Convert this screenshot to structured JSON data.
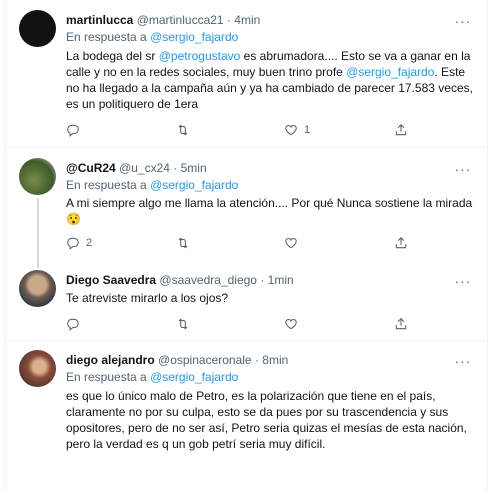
{
  "tweets": [
    {
      "name": "martinlucca",
      "handle": "@martinlucca21",
      "time": "· 4min",
      "reply_prefix": "En respuesta a",
      "reply_to": "@sergio_fajardo",
      "body_a": "La bodega del sr ",
      "body_mention_1": "@petrogustavo",
      "body_b": " es abrumadora.... Esto se va a ganar en la calle y no en la redes sociales, muy buen trino profe ",
      "body_mention_2": "@sergio_fajardo",
      "body_c": ". Este no ha llegado a la campaña aún y ya ha cambiado de parecer 17.583 veces, es un politiquero de 1era",
      "reply_count": "",
      "retweet_count": "",
      "like_count": "1"
    },
    {
      "name": "@CuR24",
      "handle": "@u_cx24",
      "time": "· 5min",
      "reply_prefix": "En respuesta a",
      "reply_to": "@sergio_fajardo",
      "body": "A mi siempre algo me llama la atención.... Por qué Nunca sostiene la mirada 😯",
      "reply_count": "2",
      "retweet_count": "",
      "like_count": ""
    },
    {
      "name": "Diego Saavedra",
      "handle": "@saavedra_diego",
      "time": "· 1min",
      "body": "Te atreviste mirarlo a los ojos?",
      "reply_count": "",
      "retweet_count": "",
      "like_count": ""
    },
    {
      "name": "diego alejandro",
      "handle": "@ospinaceronale",
      "time": "· 8min",
      "reply_prefix": "En respuesta a",
      "reply_to": "@sergio_fajardo",
      "body": "es que lo único malo de Petro, es la polarización que tiene en el país, claramente no por su culpa, esto se da pues por su trascendencia y sus opositores, pero de no ser así, Petro seria quizas el mesías de esta nación, pero la verdad es q un gob petrí seria muy difícil."
    }
  ],
  "colors": {
    "link": "#1d9bf0",
    "muted": "#536471",
    "text": "#0f1419",
    "border": "#eff3f4"
  },
  "icons": [
    "more-icon",
    "reply-icon",
    "retweet-icon",
    "like-icon",
    "share-icon"
  ]
}
